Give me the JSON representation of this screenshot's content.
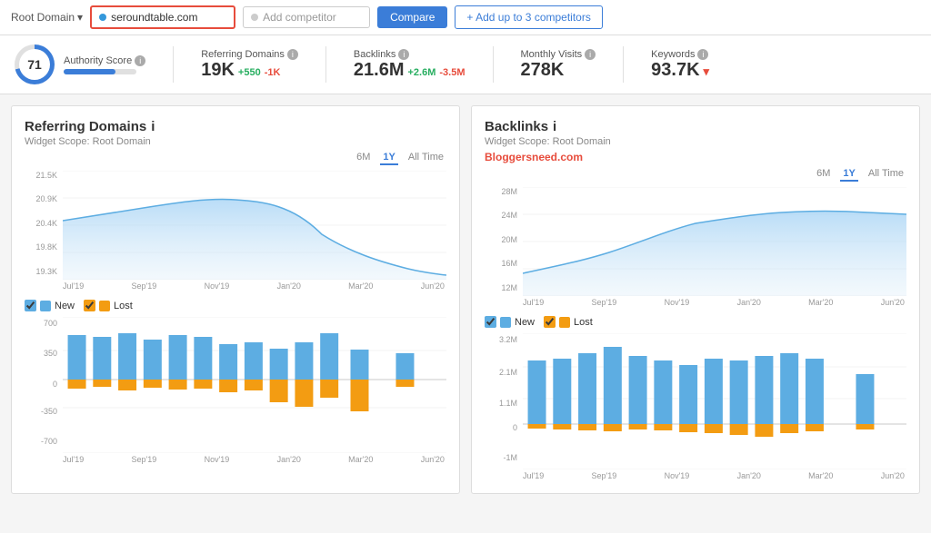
{
  "topbar": {
    "root_domain_label": "Root Domain",
    "chevron": "▾",
    "domain": "seroundtable.com",
    "add_competitor_placeholder": "Add competitor",
    "compare_btn": "Compare",
    "add_competitors_btn": "+ Add up to 3 competitors"
  },
  "metrics": {
    "authority_score": {
      "label": "Authority Score",
      "value": "71",
      "percent": 71
    },
    "referring_domains": {
      "label": "Referring Domains",
      "value": "19K",
      "pos": "+550",
      "neg": "-1K"
    },
    "backlinks": {
      "label": "Backlinks",
      "value": "21.6M",
      "pos": "+2.6M",
      "neg": "-3.5M"
    },
    "monthly_visits": {
      "label": "Monthly Visits",
      "value": "278K"
    },
    "keywords": {
      "label": "Keywords",
      "value": "93.7K",
      "trend": "▾"
    }
  },
  "left_chart": {
    "title": "Referring Domains",
    "subtitle": "Widget Scope: Root Domain",
    "time_options": [
      "6M",
      "1Y",
      "All Time"
    ],
    "active_time": "1Y",
    "y_labels": [
      "21.5K",
      "20.9K",
      "20.4K",
      "19.8K",
      "19.3K"
    ],
    "x_labels": [
      "Jul'19",
      "Sep'19",
      "Nov'19",
      "Jan'20",
      "Mar'20",
      "Jun'20"
    ],
    "legend_new": "New",
    "legend_lost": "Lost",
    "bar_y_labels": [
      "700",
      "350",
      "0",
      "-350",
      "-700"
    ]
  },
  "right_chart": {
    "title": "Backlinks",
    "subtitle": "Widget Scope: Root Domain",
    "bloggers_label": "Bloggersneed.com",
    "time_options": [
      "6M",
      "1Y",
      "All Time"
    ],
    "active_time": "1Y",
    "y_labels": [
      "28M",
      "24M",
      "20M",
      "16M",
      "12M"
    ],
    "x_labels": [
      "Jul'19",
      "Sep'19",
      "Nov'19",
      "Jan'20",
      "Mar'20",
      "Jun'20"
    ],
    "legend_new": "New",
    "legend_lost": "Lost",
    "bar_y_labels": [
      "3.2M",
      "2.1M",
      "1.1M",
      "0",
      "-1M"
    ]
  },
  "colors": {
    "blue": "#3b7dd8",
    "orange": "#f39c12",
    "area_fill": "#d6eaf8",
    "area_stroke": "#5dade2",
    "bar_blue": "#5dade2",
    "bar_orange": "#f39c12",
    "green": "#27ae60",
    "red": "#e74c3c"
  }
}
